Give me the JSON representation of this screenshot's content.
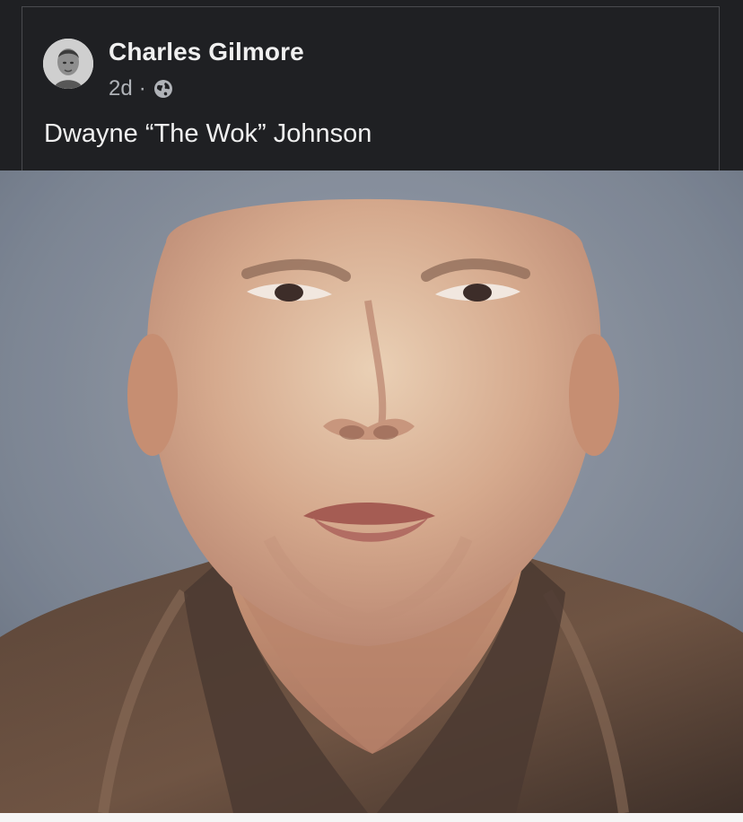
{
  "post": {
    "author": "Charles Gilmore",
    "timestamp": "2d",
    "separator": "·",
    "privacy_icon": "globe-icon",
    "text": "Dwayne “The Wok” Johnson"
  },
  "image": {
    "subject": "portrait-photo"
  },
  "colors": {
    "header_background": "#1f2023",
    "author_text": "#f0f0f0",
    "meta_text": "#b0b3b8"
  }
}
